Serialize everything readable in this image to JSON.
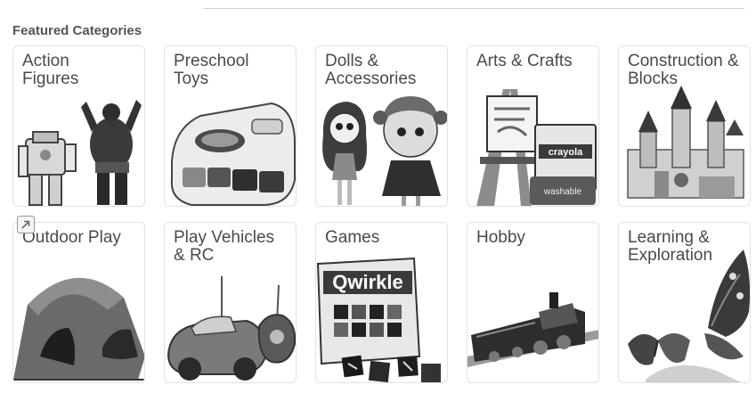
{
  "section": {
    "title": "Featured Categories"
  },
  "categories": [
    {
      "label": "Action\nFigures",
      "icon": "action-figures-image"
    },
    {
      "label": "Preschool\nToys",
      "icon": "preschool-toys-image"
    },
    {
      "label": "Dolls &\nAccessories",
      "icon": "dolls-image"
    },
    {
      "label": "Arts & Crafts",
      "icon": "arts-crafts-image",
      "art_text": {
        "brand": "crayola",
        "box": "washable"
      }
    },
    {
      "label": "Construction &\nBlocks",
      "icon": "construction-blocks-image"
    },
    {
      "label": "Outdoor Play",
      "icon": "tent-image"
    },
    {
      "label": "Play Vehicles\n& RC",
      "icon": "rc-car-image"
    },
    {
      "label": "Games",
      "icon": "qwirkle-game-image",
      "art_text": {
        "brand": "Qwirkle"
      }
    },
    {
      "label": "Hobby",
      "icon": "train-image"
    },
    {
      "label": "Learning &\nExploration",
      "icon": "butterfly-image"
    }
  ],
  "colors": {
    "text": "#4a4a4a",
    "heading": "#555555",
    "border": "#e2e2e2"
  }
}
